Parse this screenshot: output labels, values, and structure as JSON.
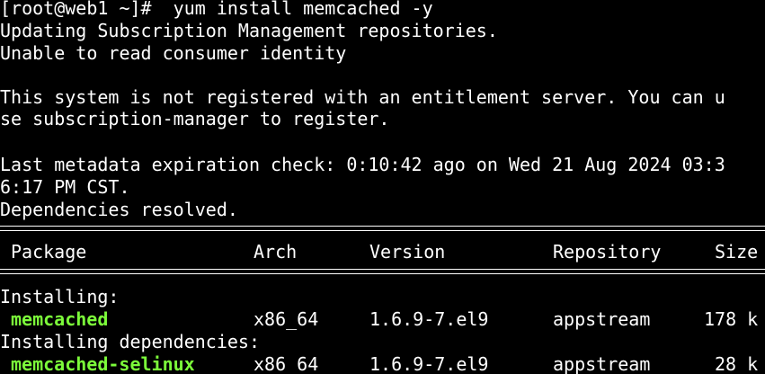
{
  "colors": {
    "background": "#000000",
    "text": "#ffffff",
    "package_name": "#7cfc3a"
  },
  "terminal": {
    "prompt": "[root@web1 ~]#  yum install memcached -y",
    "lines": [
      "Updating Subscription Management repositories.",
      "Unable to read consumer identity",
      "This system is not registered with an entitlement server. You can u",
      "se subscription-manager to register.",
      "Last metadata expiration check: 0:10:42 ago on Wed 21 Aug 2024 03:3",
      "6:17 PM CST.",
      "Dependencies resolved."
    ],
    "table": {
      "headers": {
        "package": "Package",
        "arch": "Arch",
        "version": "Version",
        "repository": "Repository",
        "size": "Size"
      },
      "sections": [
        {
          "title": "Installing:",
          "rows": [
            {
              "package": "memcached",
              "arch": "x86_64",
              "version": "1.6.9-7.el9",
              "repository": "appstream",
              "size": "178 k"
            }
          ]
        },
        {
          "title": "Installing dependencies:",
          "rows": [
            {
              "package": "memcached-selinux",
              "arch": "x86_64",
              "version": "1.6.9-7.el9",
              "repository": "appstream",
              "size": "28 k"
            }
          ]
        }
      ]
    }
  }
}
